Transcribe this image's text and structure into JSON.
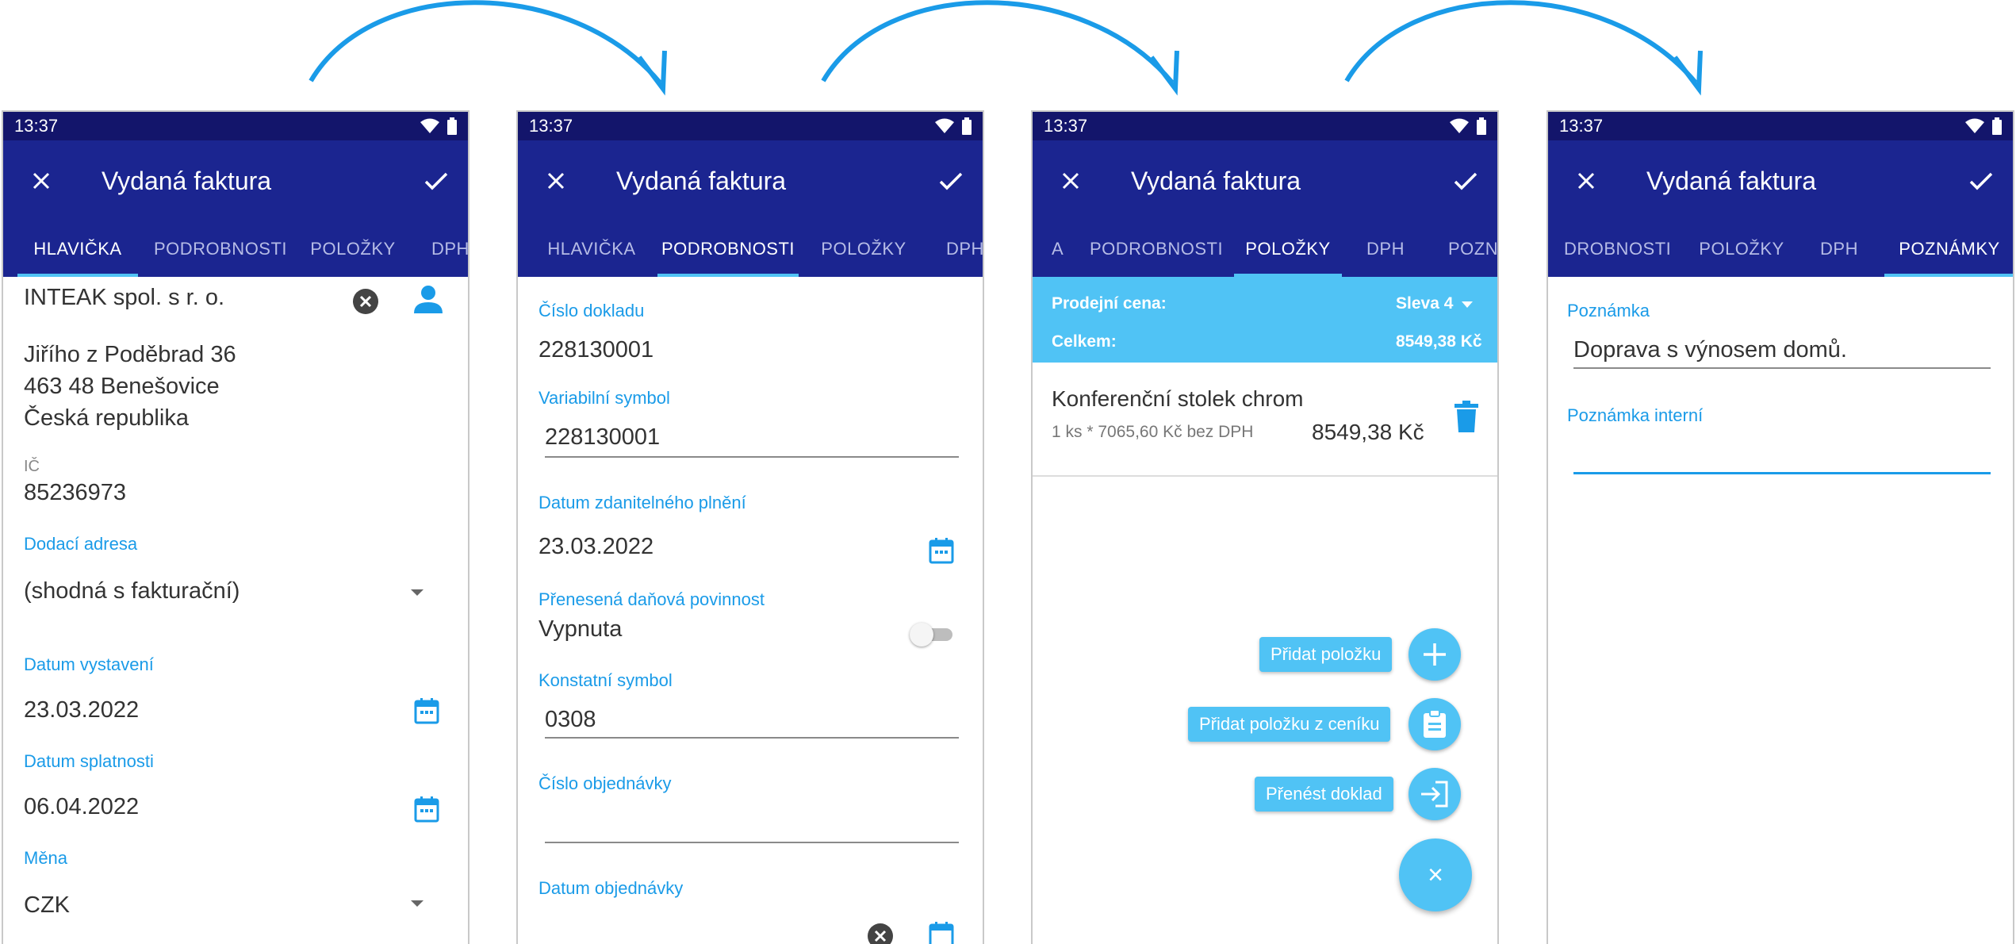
{
  "status_time": "13:37",
  "app_title": "Vydaná faktura",
  "colors": {
    "statusbar": "#13156b",
    "appbar": "#1b2590",
    "accent": "#50c3f5",
    "label": "#1a9be8",
    "arrow": "#1a9be8"
  },
  "icons": [
    "close-icon",
    "check-icon",
    "wifi-icon",
    "battery-icon",
    "clear-icon",
    "person-icon",
    "calendar-icon",
    "dropdown-arrow-icon",
    "delete-icon",
    "add-icon",
    "clipboard-icon",
    "transfer-icon"
  ],
  "screen1": {
    "tabs": [
      "HLAVIČKA",
      "PODROBNOSTI",
      "POLOŽKY",
      "DPH"
    ],
    "company": "INTEAK spol. s r. o.",
    "address_line1": "Jiřího z Poděbrad 36",
    "address_line2": "463 48 Benešovice",
    "address_line3": "Česká republika",
    "ic_label": "IČ",
    "ic_value": "85236973",
    "delivery_label": "Dodací adresa",
    "delivery_value": "(shodná s fakturační)",
    "issue_label": "Datum vystavení",
    "issue_value": "23.03.2022",
    "due_label": "Datum splatnosti",
    "due_value": "06.04.2022",
    "currency_label": "Měna",
    "currency_value": "CZK"
  },
  "screen2": {
    "tabs": [
      "HLAVIČKA",
      "PODROBNOSTI",
      "POLOŽKY",
      "DPH"
    ],
    "doc_label": "Číslo dokladu",
    "doc_value": "228130001",
    "var_label": "Variabilní symbol",
    "var_value": "228130001",
    "taxdate_label": "Datum zdanitelného plnění",
    "taxdate_value": "23.03.2022",
    "reverse_label": "Přenesená daňová povinnost",
    "reverse_value": "Vypnuta",
    "const_label": "Konstatní symbol",
    "const_value": "0308",
    "order_label": "Číslo objednávky",
    "order_value": "",
    "orderdate_label": "Datum objednávky"
  },
  "screen3": {
    "tabs": [
      "A",
      "PODROBNOSTI",
      "POLOŽKY",
      "DPH",
      "POZN"
    ],
    "price_label": "Prodejní cena:",
    "price_value": "Sleva 4",
    "total_label": "Celkem:",
    "total_value": "8549,38 Kč",
    "item_name": "Konferenční stolek chrom",
    "item_detail": "1 ks * 7065,60 Kč bez DPH",
    "item_price": "8549,38 Kč",
    "add_item": "Přidat položku",
    "add_from_pricelist": "Přidat položku z ceníku",
    "transfer_doc": "Přenést doklad",
    "fab_close": "×"
  },
  "screen4": {
    "tabs": [
      "DROBNOSTI",
      "POLOŽKY",
      "DPH",
      "POZNÁMKY"
    ],
    "note_label": "Poznámka",
    "note_value": "Doprava s výnosem domů.",
    "internal_label": "Poznámka interní",
    "internal_value": ""
  }
}
